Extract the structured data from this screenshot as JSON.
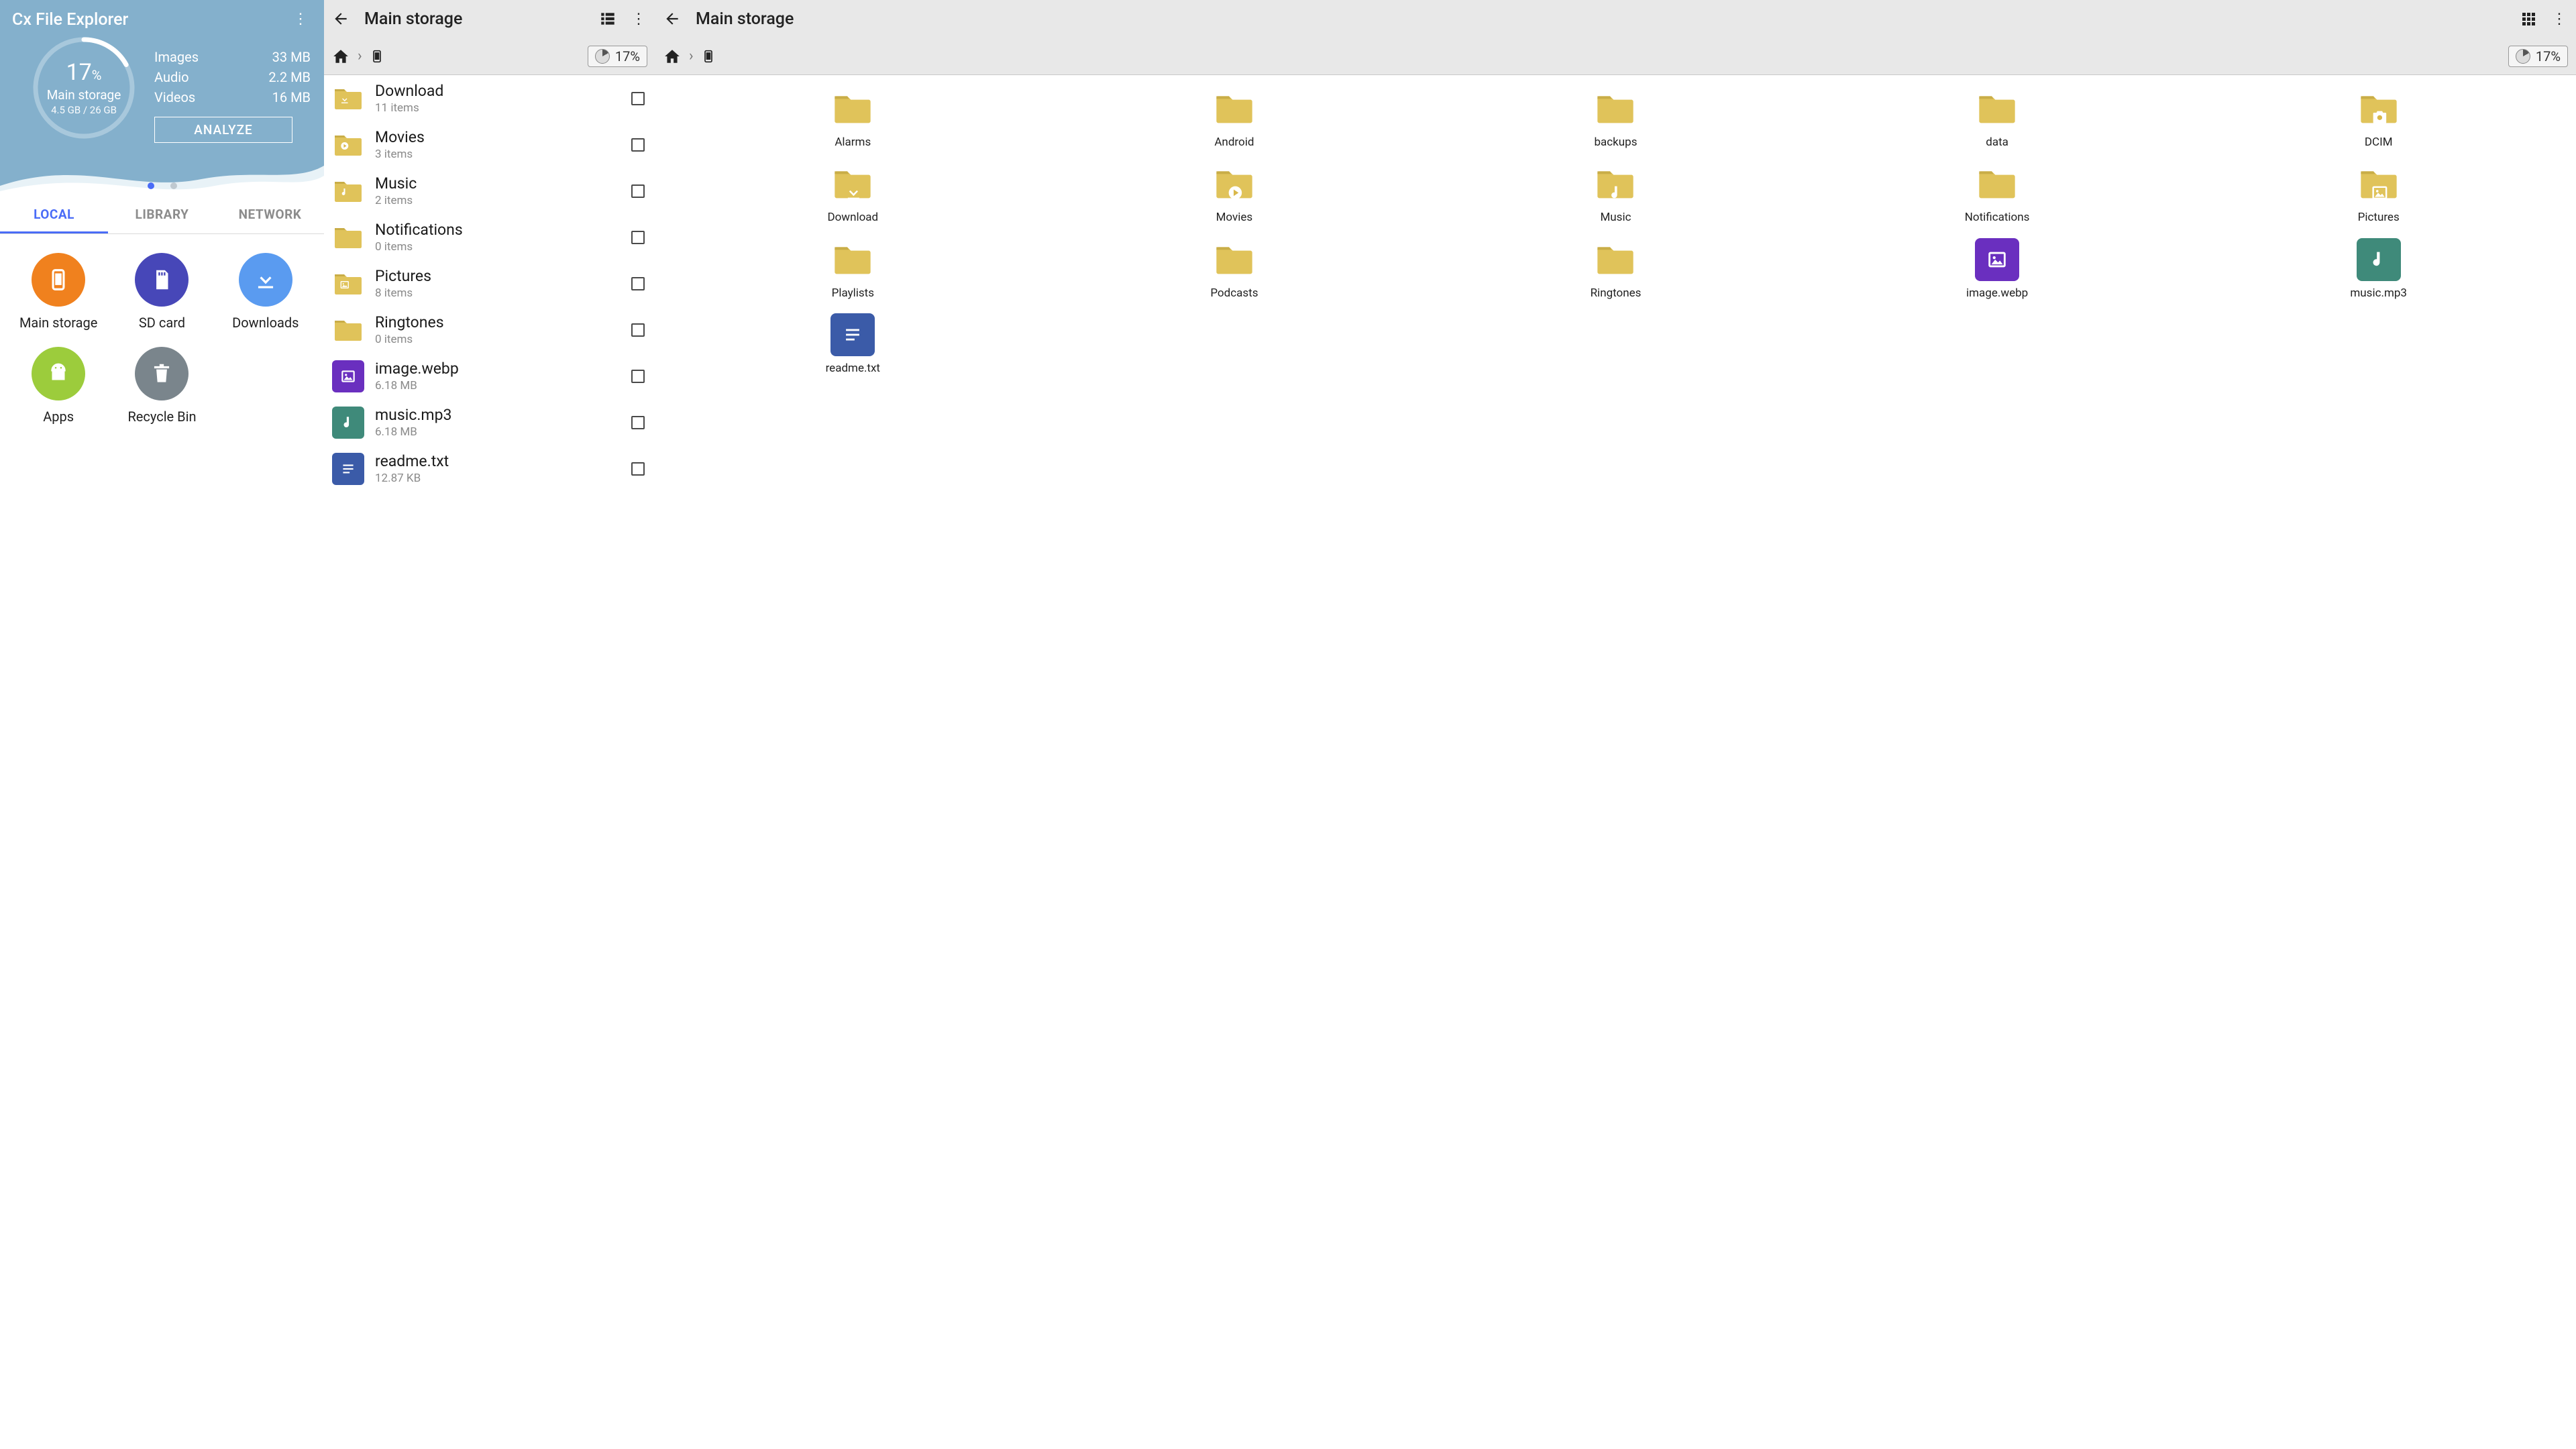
{
  "pane1": {
    "app_title": "Cx File Explorer",
    "gauge": {
      "percent_num": "17",
      "percent_sym": "%",
      "label": "Main storage",
      "sub": "4.5 GB / 26 GB",
      "pct": 17
    },
    "stats": [
      {
        "k": "Images",
        "v": "33 MB"
      },
      {
        "k": "Audio",
        "v": "2.2 MB"
      },
      {
        "k": "Videos",
        "v": "16 MB"
      }
    ],
    "analyze": "ANALYZE",
    "tabs": [
      {
        "label": "LOCAL",
        "active": true
      },
      {
        "label": "LIBRARY",
        "active": false
      },
      {
        "label": "NETWORK",
        "active": false
      }
    ],
    "locations": [
      {
        "label": "Main storage",
        "color": "c-orange",
        "icon": "phone"
      },
      {
        "label": "SD card",
        "color": "c-purple",
        "icon": "sd"
      },
      {
        "label": "Downloads",
        "color": "c-blue",
        "icon": "download"
      },
      {
        "label": "Apps",
        "color": "c-green",
        "icon": "android"
      },
      {
        "label": "Recycle Bin",
        "color": "c-gray",
        "icon": "trash"
      }
    ]
  },
  "pane2": {
    "title": "Main storage",
    "storage_pct": "17%",
    "items": [
      {
        "name": "Download",
        "sub": "11 items",
        "type": "folder",
        "glyph": "download"
      },
      {
        "name": "Movies",
        "sub": "3 items",
        "type": "folder",
        "glyph": "play"
      },
      {
        "name": "Music",
        "sub": "2 items",
        "type": "folder",
        "glyph": "note"
      },
      {
        "name": "Notifications",
        "sub": "0 items",
        "type": "folder",
        "glyph": ""
      },
      {
        "name": "Pictures",
        "sub": "8 items",
        "type": "folder",
        "glyph": "image"
      },
      {
        "name": "Ringtones",
        "sub": "0 items",
        "type": "folder",
        "glyph": ""
      },
      {
        "name": "image.webp",
        "sub": "6.18 MB",
        "type": "file",
        "tile": "t-purple",
        "glyph": "image"
      },
      {
        "name": "music.mp3",
        "sub": "6.18 MB",
        "type": "file",
        "tile": "t-teal",
        "glyph": "note"
      },
      {
        "name": "readme.txt",
        "sub": "12.87 KB",
        "type": "file",
        "tile": "t-navy",
        "glyph": "lines"
      }
    ]
  },
  "pane3": {
    "title": "Main storage",
    "storage_pct": "17%",
    "items": [
      {
        "name": "Alarms",
        "type": "folder",
        "glyph": ""
      },
      {
        "name": "Android",
        "type": "folder",
        "glyph": ""
      },
      {
        "name": "backups",
        "type": "folder",
        "glyph": ""
      },
      {
        "name": "data",
        "type": "folder",
        "glyph": ""
      },
      {
        "name": "DCIM",
        "type": "folder",
        "glyph": "camera"
      },
      {
        "name": "Download",
        "type": "folder",
        "glyph": "download"
      },
      {
        "name": "Movies",
        "type": "folder",
        "glyph": "play"
      },
      {
        "name": "Music",
        "type": "folder",
        "glyph": "note"
      },
      {
        "name": "Notifica­tions",
        "type": "folder",
        "glyph": ""
      },
      {
        "name": "Pictures",
        "type": "folder",
        "glyph": "image"
      },
      {
        "name": "Playlists",
        "type": "folder",
        "glyph": ""
      },
      {
        "name": "Podcasts",
        "type": "folder",
        "glyph": ""
      },
      {
        "name": "Ringtones",
        "type": "folder",
        "glyph": ""
      },
      {
        "name": "image.webp",
        "type": "file",
        "tile": "t-purple",
        "glyph": "image"
      },
      {
        "name": "music.mp3",
        "type": "file",
        "tile": "t-teal",
        "glyph": "note"
      },
      {
        "name": "readme.txt",
        "type": "file",
        "tile": "t-navy",
        "glyph": "lines"
      }
    ]
  }
}
